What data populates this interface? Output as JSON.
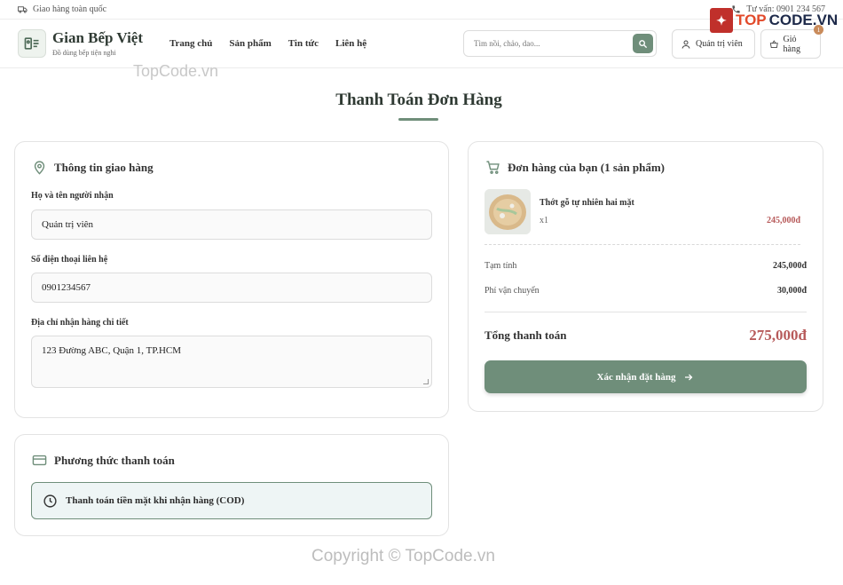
{
  "topbar": {
    "shipping_text": "Giao hàng toàn quốc",
    "hotline_text": "Tư vấn: 0901 234 567"
  },
  "brand": {
    "name": "Gian Bếp Việt",
    "tagline": "Đồ dùng bếp tiện nghi"
  },
  "nav": {
    "items": [
      {
        "label": "Trang chủ"
      },
      {
        "label": "Sản phẩm"
      },
      {
        "label": "Tin tức"
      },
      {
        "label": "Liên hệ"
      }
    ]
  },
  "search": {
    "placeholder": "Tìm nồi, chảo, dao..."
  },
  "header_actions": {
    "user_label": "Quản trị viên",
    "cart_label": "Giỏ hàng",
    "cart_count": "1"
  },
  "watermark": {
    "logo_text_1": "TOP",
    "logo_text_2": "CODE.VN",
    "site_text": "TopCode.vn",
    "copyright": "Copyright © TopCode.vn"
  },
  "page": {
    "title": "Thanh Toán Đơn Hàng"
  },
  "shipping_form": {
    "heading": "Thông tin giao hàng",
    "name_label": "Họ và tên người nhận",
    "name_value": "Quản trị viên",
    "phone_label": "Số điện thoại liên hệ",
    "phone_value": "0901234567",
    "address_label": "Địa chỉ nhận hàng chi tiết",
    "address_value": "123 Đường ABC, Quận 1, TP.HCM"
  },
  "payment": {
    "heading": "Phương thức thanh toán",
    "option_label": "Thanh toán tiền mặt khi nhận hàng (COD)"
  },
  "order": {
    "heading": "Đơn hàng của bạn (1 sản phẩm)",
    "items": [
      {
        "name": "Thớt gỗ tự nhiên hai mặt",
        "qty": "x1",
        "price": "245,000đ"
      }
    ],
    "subtotal_label": "Tạm tính",
    "subtotal_value": "245,000đ",
    "shipping_label": "Phí vận chuyển",
    "shipping_value": "30,000đ",
    "total_label": "Tổng thanh toán",
    "total_value": "275,000đ",
    "confirm_label": "Xác nhận đặt hàng"
  },
  "colors": {
    "accent": "#6f8e7a",
    "price": "#b75a5a"
  }
}
